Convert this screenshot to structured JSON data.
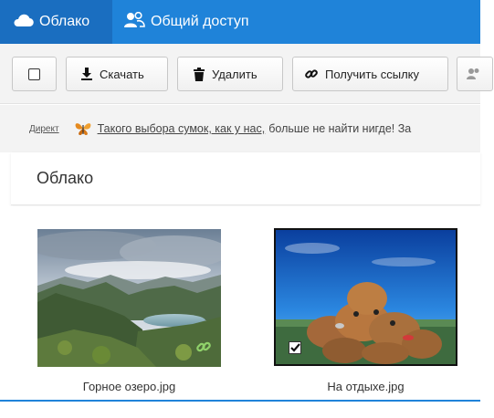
{
  "nav": {
    "tabs": [
      {
        "label": "Облако",
        "icon": "cloud-icon",
        "active": true
      },
      {
        "label": "Общий доступ",
        "icon": "people-icon",
        "active": false
      }
    ],
    "bg_color": "#1f83d9",
    "active_color": "#1a6ec0"
  },
  "toolbar": {
    "download_label": "Скачать",
    "delete_label": "Удалить",
    "get_link_label": "Получить ссылку"
  },
  "ad": {
    "label": "Директ",
    "link_text": "Такого выбора сумок, как у нас,",
    "text": "больше не найти нигде! За"
  },
  "folder": {
    "title": "Облако"
  },
  "files": [
    {
      "name": "Горное озеро.jpg",
      "shared_link": true,
      "selected": false
    },
    {
      "name": "На отдыхе.jpg",
      "shared_link": false,
      "selected": true
    }
  ]
}
